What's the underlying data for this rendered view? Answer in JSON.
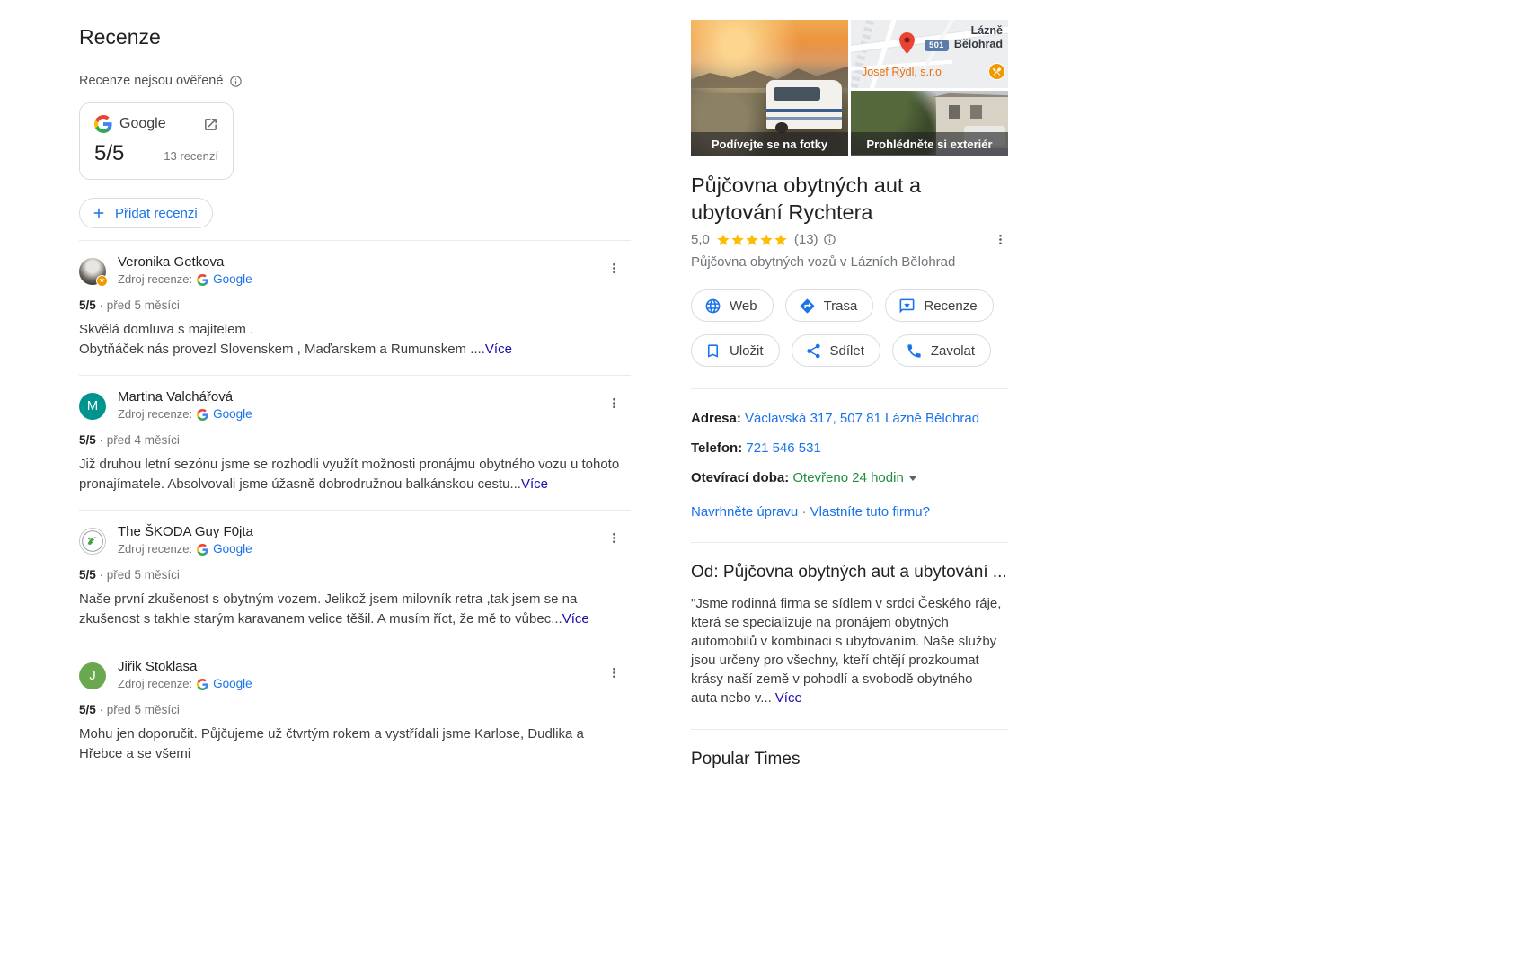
{
  "left": {
    "heading": "Recenze",
    "verify_note": "Recenze nejsou ověřené",
    "card": {
      "provider": "Google",
      "score": "5/5",
      "count": "13 recenzí"
    },
    "add_review_label": "Přidat recenzi",
    "source_label": "Zdroj recenze:",
    "reviews": [
      {
        "name": "Veronika Getkova",
        "source": "Google",
        "rating": "5/5",
        "time": "před 5 měsíci",
        "para1": "Skvělá domluva s majitelem .",
        "para2": "Obytňáček nás provezl Slovenskem , Maďarskem a Rumunskem ....",
        "more": "Více"
      },
      {
        "name": "Martina Valchářová",
        "source": "Google",
        "rating": "5/5",
        "time": "před 4 měsíci",
        "para1": "Již druhou letní sezónu jsme se rozhodli využít možnosti pronájmu obytného vozu u tohoto pronajímatele. Absolvovali jsme úžasně dobrodružnou balkánskou cestu...",
        "more": "Více",
        "avatar_letter": "M",
        "avatar_color": "#00948f"
      },
      {
        "name": "The ŠKODA Guy F0jta",
        "source": "Google",
        "rating": "5/5",
        "time": "před 5 měsíci",
        "para1": "Naše první zkušenost s obytným vozem. Jelikož jsem milovník retra ,tak jsem se na zkušenost s takhle starým karavanem velice těšil. A musím říct, že mě to vůbec...",
        "more": "Více"
      },
      {
        "name": "Jiřik Stoklasa",
        "source": "Google",
        "rating": "5/5",
        "time": "před 5 měsíci",
        "para1": "Mohu jen doporučit. Půjčujeme už čtvrtým rokem a vystřídali jsme Karlose, Dudlika a Hřebce a se všemi",
        "more": "",
        "avatar_letter": "J",
        "avatar_color": "#6aa84f"
      }
    ]
  },
  "panel": {
    "photos": {
      "left_caption": "Podívejte se na fotky",
      "right_caption": "Prohlédněte si exteriér"
    },
    "map": {
      "route_badge": "501",
      "town": "Lázně Bělohrad",
      "poi": "Josef Rýdl, s.r.o"
    },
    "title": "Půjčovna obytných aut a ubytování Rychtera",
    "rating": {
      "score": "5,0",
      "count": "(13)"
    },
    "subtitle": "Půjčovna obytných vozů v Lázních Bělohrad",
    "actions": {
      "web": "Web",
      "directions": "Trasa",
      "reviews": "Recenze",
      "save": "Uložit",
      "share": "Sdílet",
      "call": "Zavolat"
    },
    "details": {
      "address_label": "Adresa:",
      "address": "Václavská 317, 507 81 Lázně Bělohrad",
      "phone_label": "Telefon:",
      "phone": "721 546 531",
      "hours_label": "Otevírací doba:",
      "hours": "Otevřeno 24 hodin",
      "suggest_edit": "Navrhněte úpravu",
      "claim": "Vlastníte tuto firmu?"
    },
    "about": {
      "heading": "Od: Půjčovna obytných aut a ubytování ...",
      "text": "\"Jsme rodinná firma se sídlem v srdci Českého ráje, která se specializuje na pronájem obytných automobilů v kombinaci s ubytováním. Naše služby jsou určeny pro všechny, kteří chtějí prozkoumat krásy naší země v pohodlí a svobodě obytného auta nebo v...",
      "more": "Více"
    },
    "popular_times": "Popular Times"
  },
  "colors": {
    "link_blue": "#1a73e8",
    "open_green": "#1e8e3e",
    "star_gold": "#fbbc04",
    "poi_orange": "#e8710a"
  }
}
